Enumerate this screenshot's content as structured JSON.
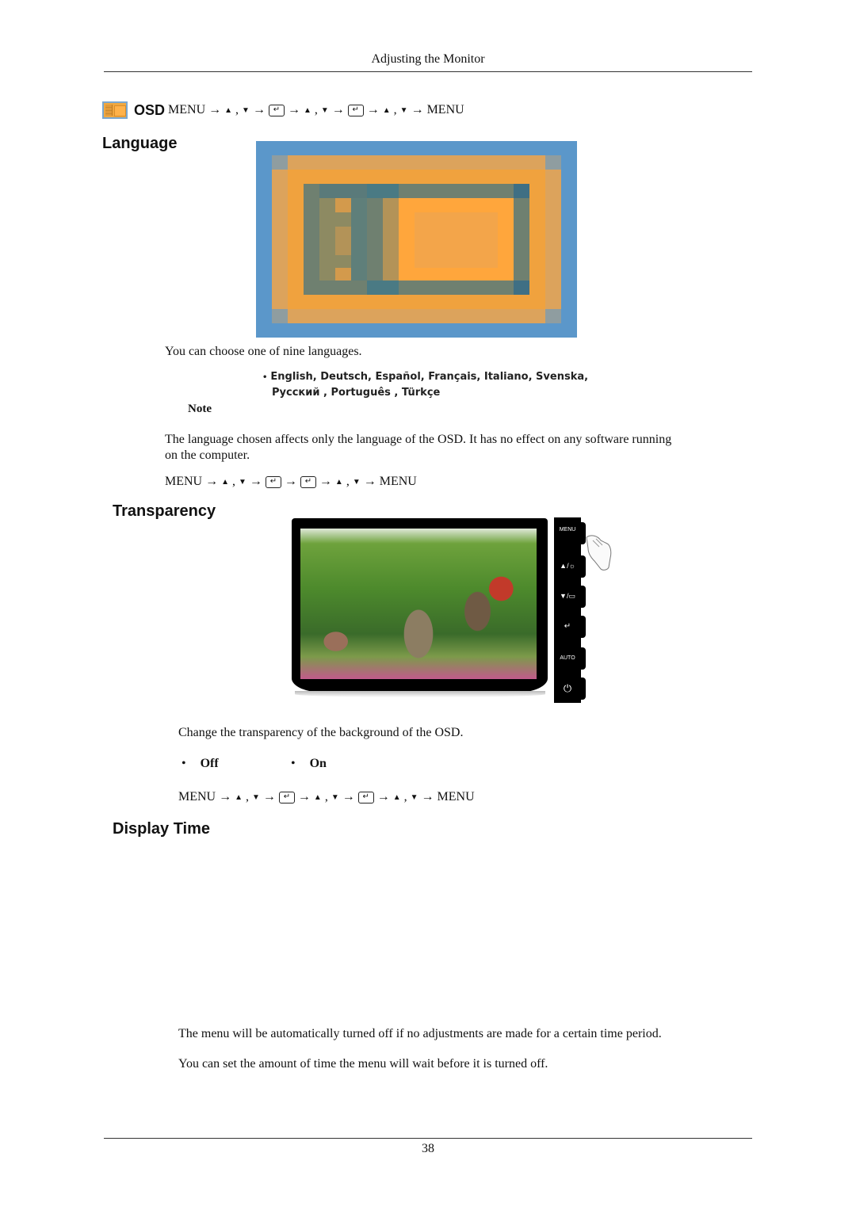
{
  "header": {
    "title": "Adjusting the Monitor"
  },
  "osd_path": {
    "label": "OSD",
    "icon": "osd-menu-icon",
    "steps": [
      "MENU",
      "→",
      "▲",
      ",",
      "▼",
      "→",
      "enter",
      "→",
      "▲",
      ",",
      "▼",
      "→",
      "enter",
      "→",
      "▲",
      ",",
      "▼",
      "→",
      "MENU"
    ]
  },
  "language": {
    "heading": "Language",
    "image": "language-osd-illustration",
    "description": "You can choose one of nine languages.",
    "options_line1": "English, Deutsch, Español, Français,  Italiano, Svenska,",
    "options_line2": "Русский , Português , Türkçe",
    "bullet": "•",
    "note_label": "Note",
    "note_text_line1": "The language chosen affects only the language of the OSD. It has no effect on any software running",
    "note_text_line2": "on the computer.",
    "nav": {
      "menu_start": "MENU",
      "arrow": "→",
      "up": "▲",
      "comma": ",",
      "down": "▼",
      "enter": "↵",
      "menu_end": "MENU"
    }
  },
  "transparency": {
    "heading": "Transparency",
    "image": "monitor-garden-photo",
    "side_buttons": [
      "MENU",
      "▲/☼",
      "▼/▭",
      "↵",
      "AUTO",
      "⏻"
    ],
    "description": "Change the transparency of the background of the OSD.",
    "options": [
      "Off",
      "On"
    ],
    "bullet": "•",
    "nav": {
      "menu_start": "MENU",
      "arrow": "→",
      "up": "▲",
      "comma": ",",
      "down": "▼",
      "enter": "↵",
      "menu_end": "MENU"
    }
  },
  "display_time": {
    "heading": "Display Time",
    "text_line1": "The menu will be automatically turned off if no adjustments are made for a certain time period.",
    "text_line2": "You can set the amount of time the menu will wait before it is turned off."
  },
  "footer": {
    "page_number": "38"
  }
}
